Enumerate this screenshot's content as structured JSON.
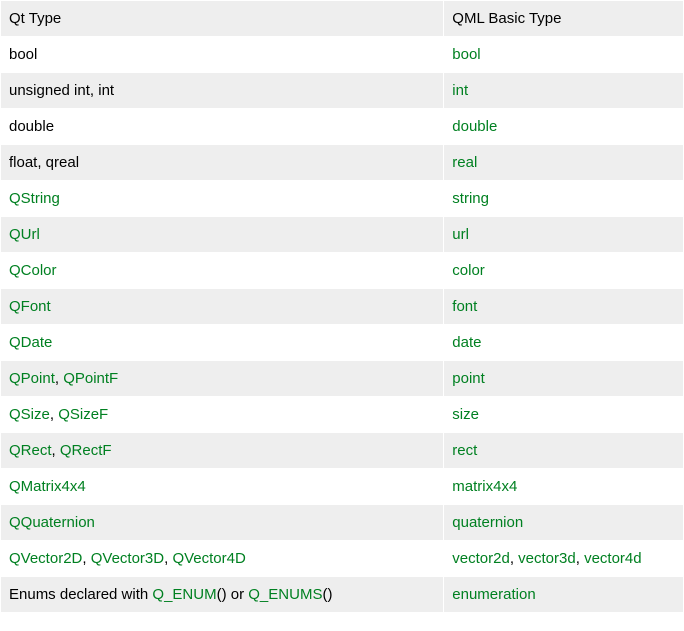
{
  "headers": {
    "qt": "Qt Type",
    "qml": "QML Basic Type"
  },
  "rows": [
    {
      "qt": [
        {
          "t": "plain",
          "v": "bool"
        }
      ],
      "qml": [
        {
          "t": "link",
          "v": "bool"
        }
      ]
    },
    {
      "qt": [
        {
          "t": "plain",
          "v": "unsigned int, int"
        }
      ],
      "qml": [
        {
          "t": "link",
          "v": "int"
        }
      ]
    },
    {
      "qt": [
        {
          "t": "plain",
          "v": "double"
        }
      ],
      "qml": [
        {
          "t": "link",
          "v": "double"
        }
      ]
    },
    {
      "qt": [
        {
          "t": "plain",
          "v": "float, qreal"
        }
      ],
      "qml": [
        {
          "t": "link",
          "v": "real"
        }
      ]
    },
    {
      "qt": [
        {
          "t": "link",
          "v": "QString"
        }
      ],
      "qml": [
        {
          "t": "link",
          "v": "string"
        }
      ]
    },
    {
      "qt": [
        {
          "t": "link",
          "v": "QUrl"
        }
      ],
      "qml": [
        {
          "t": "link",
          "v": "url"
        }
      ]
    },
    {
      "qt": [
        {
          "t": "link",
          "v": "QColor"
        }
      ],
      "qml": [
        {
          "t": "link",
          "v": "color"
        }
      ]
    },
    {
      "qt": [
        {
          "t": "link",
          "v": "QFont"
        }
      ],
      "qml": [
        {
          "t": "link",
          "v": "font"
        }
      ]
    },
    {
      "qt": [
        {
          "t": "link",
          "v": "QDate"
        }
      ],
      "qml": [
        {
          "t": "link",
          "v": "date"
        }
      ]
    },
    {
      "qt": [
        {
          "t": "link",
          "v": "QPoint"
        },
        {
          "t": "plain",
          "v": ", "
        },
        {
          "t": "link",
          "v": "QPointF"
        }
      ],
      "qml": [
        {
          "t": "link",
          "v": "point"
        }
      ]
    },
    {
      "qt": [
        {
          "t": "link",
          "v": "QSize"
        },
        {
          "t": "plain",
          "v": ", "
        },
        {
          "t": "link",
          "v": "QSizeF"
        }
      ],
      "qml": [
        {
          "t": "link",
          "v": "size"
        }
      ]
    },
    {
      "qt": [
        {
          "t": "link",
          "v": "QRect"
        },
        {
          "t": "plain",
          "v": ", "
        },
        {
          "t": "link",
          "v": "QRectF"
        }
      ],
      "qml": [
        {
          "t": "link",
          "v": "rect"
        }
      ]
    },
    {
      "qt": [
        {
          "t": "link",
          "v": "QMatrix4x4"
        }
      ],
      "qml": [
        {
          "t": "link",
          "v": "matrix4x4"
        }
      ]
    },
    {
      "qt": [
        {
          "t": "link",
          "v": "QQuaternion"
        }
      ],
      "qml": [
        {
          "t": "link",
          "v": "quaternion"
        }
      ]
    },
    {
      "qt": [
        {
          "t": "link",
          "v": "QVector2D"
        },
        {
          "t": "plain",
          "v": ", "
        },
        {
          "t": "link",
          "v": "QVector3D"
        },
        {
          "t": "plain",
          "v": ", "
        },
        {
          "t": "link",
          "v": "QVector4D"
        }
      ],
      "qml": [
        {
          "t": "link",
          "v": "vector2d"
        },
        {
          "t": "plain",
          "v": ", "
        },
        {
          "t": "link",
          "v": "vector3d"
        },
        {
          "t": "plain",
          "v": ", "
        },
        {
          "t": "link",
          "v": "vector4d"
        }
      ]
    },
    {
      "qt": [
        {
          "t": "plain",
          "v": "Enums declared with "
        },
        {
          "t": "link",
          "v": "Q_ENUM"
        },
        {
          "t": "plain",
          "v": "() or "
        },
        {
          "t": "link",
          "v": "Q_ENUMS"
        },
        {
          "t": "plain",
          "v": "()"
        }
      ],
      "qml": [
        {
          "t": "link",
          "v": "enumeration"
        }
      ]
    }
  ]
}
